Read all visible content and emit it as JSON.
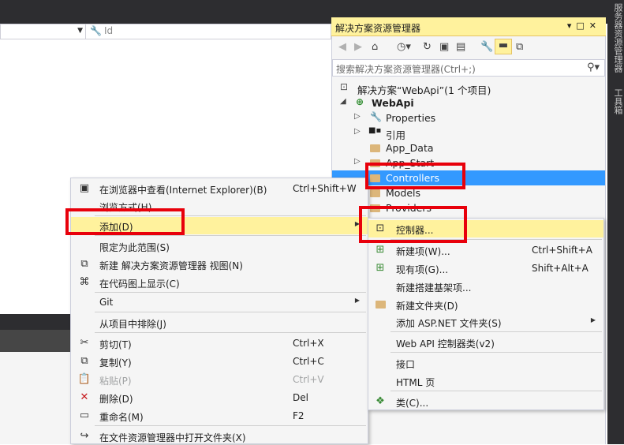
{
  "properties": {
    "field": "Id"
  },
  "solution_explorer": {
    "title": "解决方案资源管理器",
    "title_buttons": [
      "▾",
      "□",
      "✕"
    ],
    "search_placeholder": "搜索解决方案资源管理器(Ctrl+;)",
    "tree": {
      "solution": "解决方案“WebApi”(1 个项目)",
      "project": "WebApi",
      "items": [
        "Properties",
        "引用",
        "App_Data",
        "App_Start",
        "Controllers",
        "Models",
        "Providers"
      ]
    }
  },
  "side_strip": {
    "text1": "服务器资源管理器",
    "text2": "工具箱"
  },
  "context_menu": {
    "items": [
      {
        "label": "在浏览器中查看(Internet Explorer)(B)",
        "shortcut": "Ctrl+Shift+W"
      },
      {
        "label": "浏览方式(H)...",
        "shortcut": ""
      },
      {
        "label": "添加(D)",
        "shortcut": ""
      },
      {
        "label": "限定为此范围(S)",
        "shortcut": ""
      },
      {
        "label": "新建 解决方案资源管理器 视图(N)",
        "shortcut": ""
      },
      {
        "label": "在代码图上显示(C)",
        "shortcut": ""
      },
      {
        "label": "Git",
        "shortcut": ""
      },
      {
        "label": "从项目中排除(J)",
        "shortcut": ""
      },
      {
        "label": "剪切(T)",
        "shortcut": "Ctrl+X"
      },
      {
        "label": "复制(Y)",
        "shortcut": "Ctrl+C"
      },
      {
        "label": "粘贴(P)",
        "shortcut": "Ctrl+V"
      },
      {
        "label": "删除(D)",
        "shortcut": "Del"
      },
      {
        "label": "重命名(M)",
        "shortcut": "F2"
      },
      {
        "label": "在文件资源管理器中打开文件夹(X)",
        "shortcut": ""
      }
    ]
  },
  "add_submenu": {
    "items": [
      {
        "label": "控制器...",
        "shortcut": ""
      },
      {
        "label": "新建项(W)...",
        "shortcut": "Ctrl+Shift+A"
      },
      {
        "label": "现有项(G)...",
        "shortcut": "Shift+Alt+A"
      },
      {
        "label": "新建搭建基架项...",
        "shortcut": ""
      },
      {
        "label": "新建文件夹(D)",
        "shortcut": ""
      },
      {
        "label": "添加 ASP.NET 文件夹(S)",
        "shortcut": ""
      },
      {
        "label": "Web API 控制器类(v2)",
        "shortcut": ""
      },
      {
        "label": "接口",
        "shortcut": ""
      },
      {
        "label": "HTML 页",
        "shortcut": ""
      },
      {
        "label": "类(C)...",
        "shortcut": ""
      }
    ]
  },
  "colors": {
    "highlight": "#fff29d",
    "selection": "#3399ff",
    "annotation": "#e8000b"
  }
}
